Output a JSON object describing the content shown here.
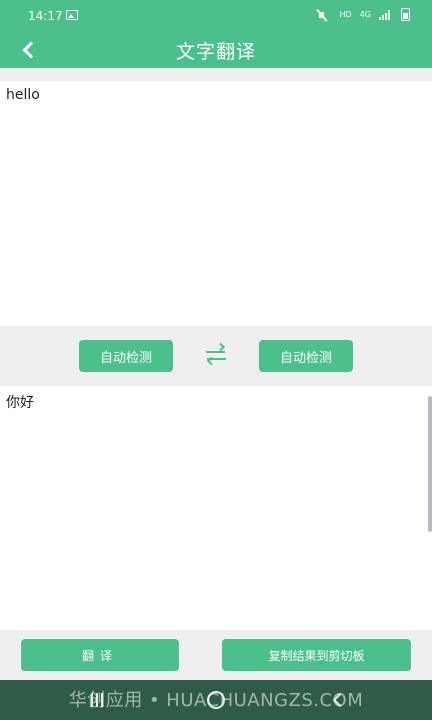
{
  "status_bar": {
    "time": "14:17",
    "hd_label": "HD",
    "network_label": "4G",
    "icons": [
      "image-icon",
      "mute-icon",
      "signal-icon",
      "battery-icon"
    ]
  },
  "header": {
    "title": "文字翻译",
    "back_icon": "back-arrow-icon"
  },
  "source": {
    "text": "hello"
  },
  "language_bar": {
    "source_language": "自动检测",
    "target_language": "自动检测",
    "swap_icon": "swap-arrows-icon"
  },
  "result": {
    "text": "你好"
  },
  "actions": {
    "translate_label": "翻译",
    "copy_label": "复制结果到剪切板"
  },
  "watermark": "华创应用 • HUACHUANGZS.COM",
  "colors": {
    "primary": "#4bbf8c",
    "background": "#efeff1",
    "nav_bar": "#2f5c48"
  }
}
